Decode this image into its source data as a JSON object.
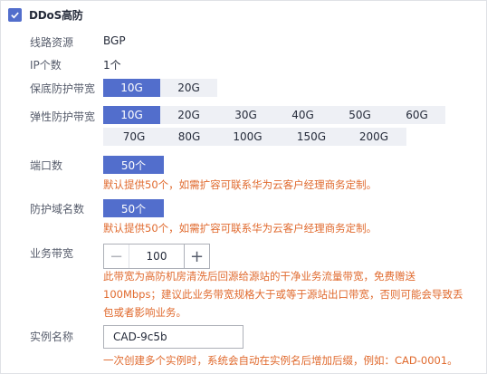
{
  "header": {
    "title": "DDoS高防"
  },
  "line": {
    "label": "线路资源",
    "value": "BGP"
  },
  "ip": {
    "label": "IP个数",
    "value": "1个"
  },
  "base_bw": {
    "label": "保底防护带宽",
    "options": [
      "10G",
      "20G"
    ],
    "selected": "10G"
  },
  "elastic_bw": {
    "label": "弹性防护带宽",
    "row1": [
      "10G",
      "20G",
      "30G",
      "40G",
      "50G",
      "60G"
    ],
    "row2": [
      "70G",
      "80G",
      "100G",
      "150G",
      "200G"
    ],
    "selected": "10G"
  },
  "ports": {
    "label": "端口数",
    "value": "50个",
    "hint": "默认提供50个，如需扩容可联系华为云客户经理商务定制。"
  },
  "domains": {
    "label": "防护域名数",
    "value": "50个",
    "hint": "默认提供50个，如需扩容可联系华为云客户经理商务定制。"
  },
  "service_bw": {
    "label": "业务带宽",
    "value": "100",
    "minus": "−",
    "plus": "+",
    "hint_line1": "此带宽为高防机房清洗后回源给源站的干净业务流量带宽，免费赠送",
    "hint_line2": "100Mbps；建议此业务带宽规格大于或等于源站出口带宽，否则可能会导致丢",
    "hint_line3": "包或者影响业务。"
  },
  "instance": {
    "label": "实例名称",
    "value": "CAD-9c5b",
    "hint": "一次创建多个实例时，系统会自动在实例名后增加后缀，例如：CAD-0001。"
  }
}
